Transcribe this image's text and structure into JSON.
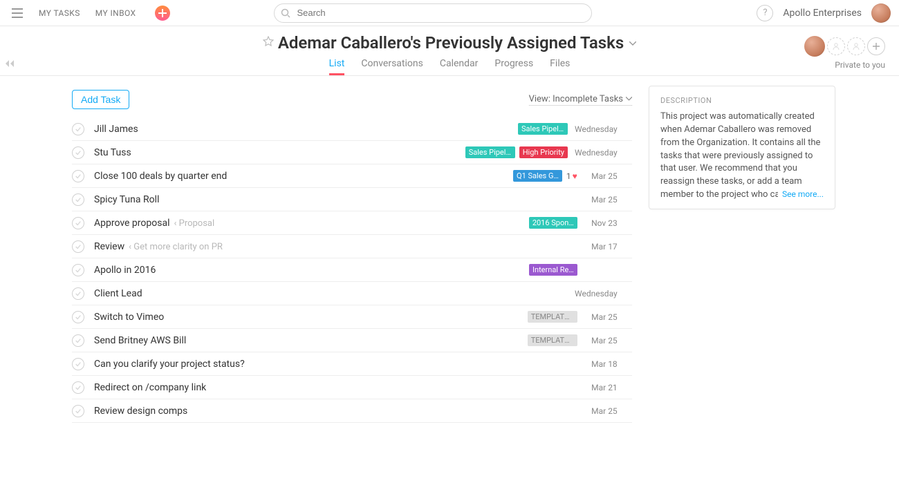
{
  "topbar": {
    "nav": [
      "MY TASKS",
      "MY INBOX"
    ],
    "search_placeholder": "Search",
    "workspace": "Apollo Enterprises"
  },
  "header": {
    "title": "Ademar Caballero's Previously Assigned Tasks",
    "tabs": [
      "List",
      "Conversations",
      "Calendar",
      "Progress",
      "Files"
    ],
    "active_tab": 0,
    "private_label": "Private to you"
  },
  "toolbar": {
    "add_task_label": "Add Task",
    "view_label": "View: Incomplete Tasks"
  },
  "tasks": [
    {
      "name": "Jill James",
      "tags": [
        {
          "text": "Sales Pipeli…",
          "cls": "teal"
        }
      ],
      "due": "Wednesday"
    },
    {
      "name": "Stu Tuss",
      "tags": [
        {
          "text": "Sales Pipeli…",
          "cls": "teal"
        },
        {
          "text": "High Priority",
          "cls": "red"
        }
      ],
      "due": "Wednesday"
    },
    {
      "name": "Close 100 deals by quarter end",
      "tags": [
        {
          "text": "Q1 Sales G…",
          "cls": "blue"
        }
      ],
      "likes": "1",
      "due": "Mar 25"
    },
    {
      "name": "Spicy Tuna Roll",
      "due": "Mar 25"
    },
    {
      "name": "Approve proposal",
      "sub": "‹ Proposal",
      "tags": [
        {
          "text": "2016 Spon…",
          "cls": "green"
        }
      ],
      "due": "Nov 23"
    },
    {
      "name": "Review",
      "sub": "‹ Get more clarity on PR",
      "due": "Mar 17"
    },
    {
      "name": "Apollo in 2016",
      "tags": [
        {
          "text": "Internal Re…",
          "cls": "purple"
        }
      ],
      "due": ""
    },
    {
      "name": "Client Lead",
      "due": "Wednesday"
    },
    {
      "name": "Switch to Vimeo",
      "tags": [
        {
          "text": "TEMPLATE:…",
          "cls": "gray"
        }
      ],
      "due": "Mar 25"
    },
    {
      "name": "Send Britney AWS Bill",
      "tags": [
        {
          "text": "TEMPLATE:…",
          "cls": "gray"
        }
      ],
      "due": "Mar 25"
    },
    {
      "name": "Can you clarify your project status?",
      "due": "Mar 18"
    },
    {
      "name": "Redirect on /company link",
      "due": "Mar 21"
    },
    {
      "name": "Review design comps",
      "due": "Mar 25"
    }
  ],
  "description": {
    "title": "DESCRIPTION",
    "body": "This project was automatically created when Ademar Caballero was removed from the Organization. It contains all the tasks that were previously assigned to that user. We recommend that you reassign these tasks, or add a team member to the project who can delegate the work.",
    "see_more": "See more..."
  }
}
